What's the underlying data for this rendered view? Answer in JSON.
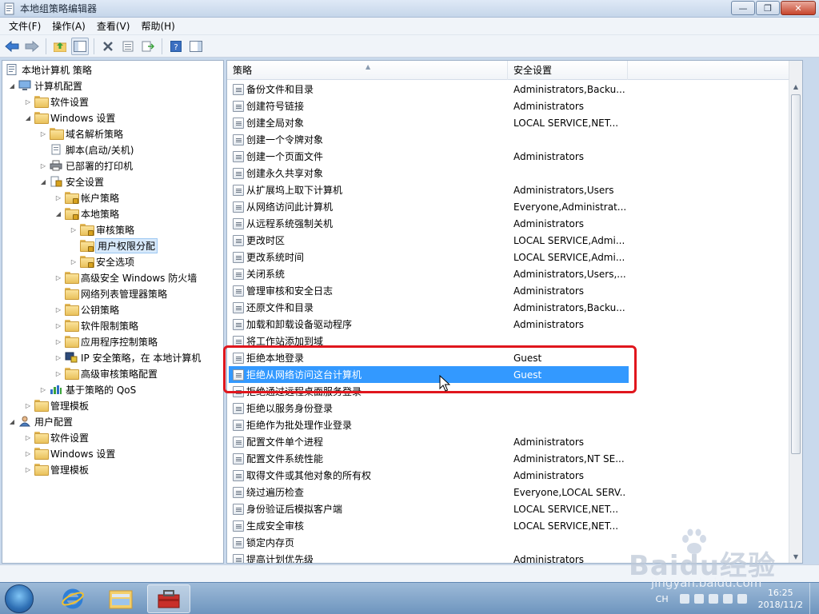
{
  "window": {
    "title": "本地组策略编辑器",
    "minimize": "—",
    "maximize": "❐",
    "close": "✕"
  },
  "menu": [
    "文件(F)",
    "操作(A)",
    "查看(V)",
    "帮助(H)"
  ],
  "tree": {
    "root": "本地计算机 策略",
    "computer_config": "计算机配置",
    "software_settings": "软件设置",
    "windows_settings": "Windows 设置",
    "dns_policy": "域名解析策略",
    "scripts": "脚本(启动/关机)",
    "printers": "已部署的打印机",
    "security_settings": "安全设置",
    "account_policy": "帐户策略",
    "local_policy": "本地策略",
    "audit_policy": "审核策略",
    "user_rights": "用户权限分配",
    "security_options": "安全选项",
    "firewall": "高级安全 Windows 防火墙",
    "netlist": "网络列表管理器策略",
    "pubkey": "公钥策略",
    "software_restriction": "软件限制策略",
    "app_control": "应用程序控制策略",
    "ipsec": "IP 安全策略，在 本地计算机",
    "adv_audit": "高级审核策略配置",
    "qos": "基于策略的 QoS",
    "admin_templates": "管理模板",
    "user_config": "用户配置",
    "u_software_settings": "软件设置",
    "u_windows_settings": "Windows 设置",
    "u_admin_templates": "管理模板"
  },
  "list": {
    "col_policy": "策略",
    "col_setting": "安全设置",
    "rows": [
      {
        "name": "备份文件和目录",
        "setting": "Administrators,Backu..."
      },
      {
        "name": "创建符号链接",
        "setting": "Administrators"
      },
      {
        "name": "创建全局对象",
        "setting": "LOCAL SERVICE,NET..."
      },
      {
        "name": "创建一个令牌对象",
        "setting": ""
      },
      {
        "name": "创建一个页面文件",
        "setting": "Administrators"
      },
      {
        "name": "创建永久共享对象",
        "setting": ""
      },
      {
        "name": "从扩展坞上取下计算机",
        "setting": "Administrators,Users"
      },
      {
        "name": "从网络访问此计算机",
        "setting": "Everyone,Administrat..."
      },
      {
        "name": "从远程系统强制关机",
        "setting": "Administrators"
      },
      {
        "name": "更改时区",
        "setting": "LOCAL SERVICE,Admi..."
      },
      {
        "name": "更改系统时间",
        "setting": "LOCAL SERVICE,Admi..."
      },
      {
        "name": "关闭系统",
        "setting": "Administrators,Users,..."
      },
      {
        "name": "管理审核和安全日志",
        "setting": "Administrators"
      },
      {
        "name": "还原文件和目录",
        "setting": "Administrators,Backu..."
      },
      {
        "name": "加载和卸载设备驱动程序",
        "setting": "Administrators"
      },
      {
        "name": "将工作站添加到域",
        "setting": ""
      },
      {
        "name": "拒绝本地登录",
        "setting": "Guest"
      },
      {
        "name": "拒绝从网络访问这台计算机",
        "setting": "Guest"
      },
      {
        "name": "拒绝通过远程桌面服务登录",
        "setting": ""
      },
      {
        "name": "拒绝以服务身份登录",
        "setting": ""
      },
      {
        "name": "拒绝作为批处理作业登录",
        "setting": ""
      },
      {
        "name": "配置文件单个进程",
        "setting": "Administrators"
      },
      {
        "name": "配置文件系统性能",
        "setting": "Administrators,NT SE..."
      },
      {
        "name": "取得文件或其他对象的所有权",
        "setting": "Administrators"
      },
      {
        "name": "绕过遍历检查",
        "setting": "Everyone,LOCAL SERV..."
      },
      {
        "name": "身份验证后模拟客户端",
        "setting": "LOCAL SERVICE,NET..."
      },
      {
        "name": "生成安全审核",
        "setting": "LOCAL SERVICE,NET..."
      },
      {
        "name": "锁定内存页",
        "setting": ""
      },
      {
        "name": "提高计划优先级",
        "setting": "Administrators"
      }
    ]
  },
  "taskbar": {
    "lang": "CH",
    "time": "16:25",
    "date": "2018/11/2"
  },
  "watermark": {
    "brand": "Baidu经验",
    "url": "jingyan.baidu.com"
  }
}
